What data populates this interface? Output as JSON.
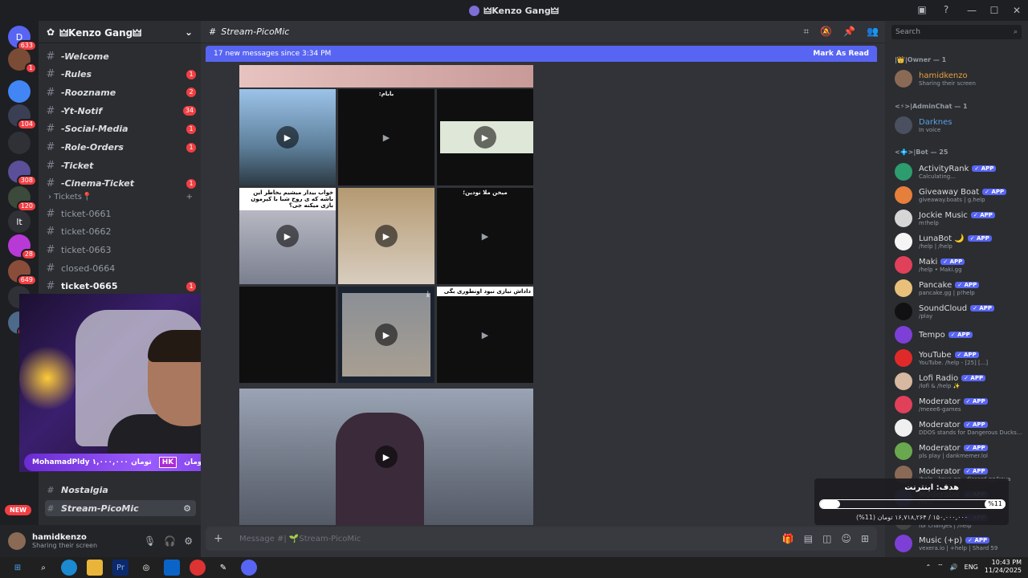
{
  "window": {
    "title": "🜲Kenzo Gang🜲",
    "controls": [
      "—",
      "☐",
      "✕"
    ]
  },
  "servers": [
    {
      "label": "D",
      "badge": "633",
      "color": "#5865f2"
    },
    {
      "label": "",
      "badge": "1",
      "color": "#7a4b35"
    },
    {
      "label": "",
      "badge": "",
      "color": "#4285f4"
    },
    {
      "label": "",
      "badge": "104",
      "color": "#3a3f54"
    },
    {
      "label": "",
      "badge": "",
      "color": "#2f3136"
    },
    {
      "label": "",
      "badge": "308",
      "color": "#5b4f9a"
    },
    {
      "label": "",
      "badge": "120",
      "color": "#3b4a3b"
    },
    {
      "label": "lt",
      "badge": "",
      "color": "#2f3136"
    },
    {
      "label": "",
      "badge": "28",
      "color": "#b83ad6"
    },
    {
      "label": "",
      "badge": "649",
      "color": "#8a4d3a"
    },
    {
      "label": "",
      "badge": "1K",
      "color": "#2f3136"
    },
    {
      "label": "",
      "badge": "316",
      "color": "#4d6a8a"
    }
  ],
  "new_badge": "NEW",
  "guild": {
    "name": "🜲Kenzo Gang🜲"
  },
  "channels": [
    {
      "name": "-Welcome",
      "badge": "",
      "style": "italic"
    },
    {
      "name": "-Rules",
      "badge": "1",
      "style": "italic"
    },
    {
      "name": "-Roozname",
      "badge": "2",
      "style": "italic"
    },
    {
      "name": "-Yt-Notif",
      "badge": "34",
      "style": "italic"
    },
    {
      "name": "-Social-Media",
      "badge": "1",
      "style": "italic"
    },
    {
      "name": "-Role-Orders",
      "badge": "1",
      "style": "italic"
    },
    {
      "name": "-Ticket",
      "badge": "",
      "style": "italic"
    },
    {
      "name": "-Cinema-Ticket",
      "badge": "1",
      "style": "italic"
    }
  ],
  "ticket_category": "Tickets📍",
  "tickets": [
    {
      "name": "ticket-0661",
      "badge": ""
    },
    {
      "name": "ticket-0662",
      "badge": ""
    },
    {
      "name": "ticket-0663",
      "badge": ""
    },
    {
      "name": "closed-0664",
      "badge": ""
    },
    {
      "name": "ticket-0665",
      "badge": "1"
    }
  ],
  "lower_channels": [
    {
      "name": "Nostalgia",
      "active": false
    },
    {
      "name": "Stream-PicoMic",
      "active": true
    }
  ],
  "stream_overlay": {
    "goal_text": "اغیار ۱,۶۰۶,۰۰۰ تومان",
    "tag": "HK",
    "donor": "MohamadPldy ۱,۰۰۰,۰۰۰ تومان"
  },
  "user": {
    "name": "hamidkenzo",
    "status": "Sharing their screen"
  },
  "channel_header": {
    "name": "Stream-PicoMic"
  },
  "new_messages": {
    "text": "17 new messages since 3:34 PM",
    "action": "Mark As Read"
  },
  "video_captions": {
    "t2": "بابام:",
    "t4": "خواب بیدار میشیم بخاطر این باشه که ی روح شبا با کیرمون بازی میکنه جی؟",
    "t6": "میخن ملا نودین؛",
    "t9": "داداش نیازی نبود اونطوری بگی"
  },
  "composer": {
    "placeholder": "Message #| 🌱Stream-PicoMic"
  },
  "search": {
    "placeholder": "Search"
  },
  "member_groups": [
    {
      "label": "|👑|Owner — 1"
    },
    {
      "label": "<⚡>|AdminChat — 1"
    },
    {
      "label": "<💠>|Bot — 25"
    }
  ],
  "members": [
    {
      "name": "hamidkenzo",
      "sub": "Sharing their screen",
      "app": false,
      "color": "#e6a23c",
      "av": "#8a6a55"
    },
    {
      "name": "Darknes",
      "sub": "In voice",
      "app": false,
      "color": "#5aa0e6",
      "av": "#4a5060"
    },
    {
      "name": "ActivityRank",
      "sub": "Calculating...",
      "app": true,
      "color": "#dbdee1",
      "av": "#2d9c6e"
    },
    {
      "name": "Giveaway Boat",
      "sub": "giveaway.boats | g.help",
      "app": true,
      "color": "#dbdee1",
      "av": "#e57f3b"
    },
    {
      "name": "Jockie Music",
      "sub": "m!help",
      "app": true,
      "color": "#dbdee1",
      "av": "#d6d6d6"
    },
    {
      "name": "LunaBot 🌙",
      "sub": "/help | /help",
      "app": true,
      "color": "#dbdee1",
      "av": "#f5f5f5"
    },
    {
      "name": "Maki",
      "sub": "/help • Maki.gg",
      "app": true,
      "color": "#dbdee1",
      "av": "#e0405a"
    },
    {
      "name": "Pancake",
      "sub": "pancake.gg | p!help",
      "app": true,
      "color": "#dbdee1",
      "av": "#e8c07a"
    },
    {
      "name": "SoundCloud",
      "sub": "/play",
      "app": true,
      "color": "#dbdee1",
      "av": "#111111"
    },
    {
      "name": "Tempo",
      "sub": "",
      "app": true,
      "color": "#dbdee1",
      "av": "#7d3fd6"
    },
    {
      "name": "YouTube",
      "sub": "YouTube. /help - [25] [...]",
      "app": true,
      "color": "#dbdee1",
      "av": "#e02a2a"
    },
    {
      "name": "Lofi Radio",
      "sub": "/lofi & /help ✨",
      "app": true,
      "color": "#dbdee1",
      "av": "#d7b8a0"
    },
    {
      "name": "Moderator",
      "sub": "/meee6-games",
      "app": true,
      "color": "#dbdee1",
      "av": "#e0405a"
    },
    {
      "name": "Moderator",
      "sub": "DDOS stands for Dangerous Ducks...",
      "app": true,
      "color": "#dbdee1",
      "av": "#f0f0f0"
    },
    {
      "name": "Moderator",
      "sub": "pls play | dankmemer.lol",
      "app": true,
      "color": "#dbdee1",
      "av": "#6aa84f"
    },
    {
      "name": "Moderator",
      "sub": "/help - koya.gg - discord.gg/koya",
      "app": true,
      "color": "#dbdee1",
      "av": "#8a6a55"
    },
    {
      "name": "Moderator",
      "sub": "/help",
      "app": true,
      "color": "#dbdee1",
      "av": "#5865f2"
    },
    {
      "name": "Moderator",
      "sub": "for changes | /help",
      "app": true,
      "color": "#dbdee1",
      "av": "#444444"
    },
    {
      "name": "Music (+p)",
      "sub": "vexera.io | +help | Shard 59",
      "app": true,
      "color": "#dbdee1",
      "av": "#7d3fd6"
    }
  ],
  "app_tag": "✓ APP",
  "goal_widget": {
    "title": "هدف: اینترنت",
    "percent": "%11",
    "progress": 11,
    "sub": "۱۵۰,۰۰۰,۰۰۰ / ۱۶,۷۱۸,۲۶۴ تومان (11%)"
  },
  "taskbar": {
    "lang": "ENG",
    "time": "10:43 PM",
    "date": "11/24/2025"
  }
}
